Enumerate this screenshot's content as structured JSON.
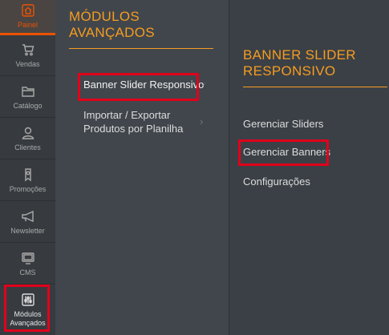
{
  "sidebar": {
    "items": [
      {
        "label": "Painel",
        "icon": "home-icon"
      },
      {
        "label": "Vendas",
        "icon": "cart-icon"
      },
      {
        "label": "Catálogo",
        "icon": "folder-icon"
      },
      {
        "label": "Clientes",
        "icon": "person-icon"
      },
      {
        "label": "Promoções",
        "icon": "tag-icon"
      },
      {
        "label": "Newsletter",
        "icon": "megaphone-icon"
      },
      {
        "label": "CMS",
        "icon": "monitor-icon"
      },
      {
        "label_line1": "Módulos",
        "label_line2": "Avançados",
        "icon": "sliders-icon"
      }
    ]
  },
  "panel1": {
    "title_line1": "MÓDULOS",
    "title_line2": "AVANÇADOS",
    "items": [
      {
        "label": "Banner Slider Responsivo"
      },
      {
        "label_line1": "Importar / Exportar",
        "label_line2": "Produtos por Planilha"
      }
    ]
  },
  "panel2": {
    "title_line1": "BANNER SLIDER",
    "title_line2": "RESPONSIVO",
    "items": [
      {
        "label": "Gerenciar Sliders"
      },
      {
        "label": "Gerenciar Banners"
      },
      {
        "label": "Configurações"
      }
    ]
  },
  "colors": {
    "accent": "#f59c20",
    "active_nav": "#eb5202",
    "highlight_box": "#e0001b"
  }
}
